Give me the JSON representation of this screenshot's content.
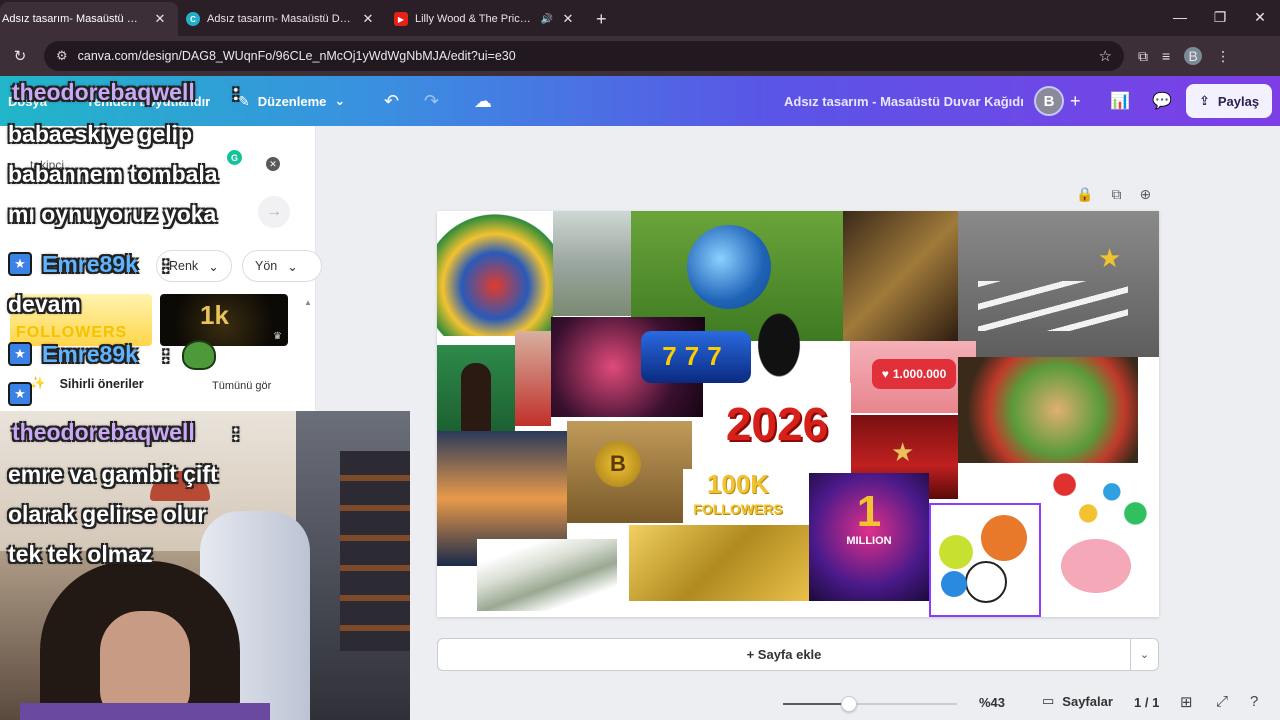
{
  "browser": {
    "tabs": [
      {
        "title": "Adsız tasarım- Masaüstü Duvar",
        "favicon_color": "#7d3ee6"
      },
      {
        "title": "Adsız tasarım- Masaüstü Duvar",
        "favicon_color": "#20b0c8"
      },
      {
        "title": "Lilly Wood & The Prick and",
        "favicon_color": "#e62117"
      }
    ],
    "new_tab": "+",
    "url": "canva.com/design/DAG8_WUqnFo/96CLe_nMcOj1yWdWgNbMJA/edit?ui=e30",
    "profile_initial": "B"
  },
  "canva": {
    "menu_file": "Dosya",
    "menu_resize": "Yeniden boyutlandır",
    "edit_label": "Düzenleme",
    "doc_title": "Adsız tasarım - Masaüstü Duvar Kağıdı",
    "avatar_initial": "B",
    "share_label": "Paylaş"
  },
  "side_panel": {
    "input_value": "takipçi",
    "chip_color": "Renk",
    "chip_direction": "Yön",
    "thumb1_text": "FOLLOWERS",
    "thumb2_text": "1k",
    "magic_label": "Sihirli öneriler",
    "see_all": "Tümünü gör"
  },
  "chat": {
    "line1_user": "theodorebaqwell",
    "line1_colon": ":",
    "line1_a": "babaeskiye gelip",
    "line1_b": "babannem tombala",
    "line1_c": "mı oynuyoruz yoka",
    "line2_user": "Emre89k",
    "line2_colon": ":",
    "line2_a": "devam",
    "line3_user": "Emre89k",
    "line3_colon": ":",
    "line4_user": "theodorebaqwell",
    "line4_colon": ":",
    "line4_a": "emre va gambit çift",
    "line4_b": "olarak gelirse olur",
    "line4_c": "tek tek olmaz"
  },
  "design": {
    "slot_text": "777",
    "year": "2026",
    "likes": "1.000.000",
    "followers_big": "100K",
    "followers_word": "FOLLOWERS",
    "million_num": "1",
    "million_word": "MILLION",
    "bitcoin": "B"
  },
  "footer": {
    "add_page": "+ Sayfa ekle",
    "zoom": "%43",
    "zoom_level": 0.38,
    "pages_label": "Sayfalar",
    "page_count": "1 / 1"
  }
}
